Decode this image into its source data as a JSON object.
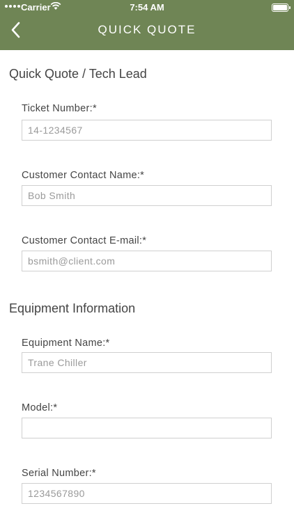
{
  "status_bar": {
    "carrier": "Carrier",
    "time": "7:54 AM"
  },
  "nav": {
    "title": "QUICK QUOTE",
    "back_icon": "chevron-left-icon",
    "background_color": "#6f8555"
  },
  "sections": {
    "lead_title": "Quick Quote / Tech Lead",
    "equipment_title": "Equipment Information"
  },
  "fields": {
    "ticket_number": {
      "label": "Ticket Number:*",
      "placeholder": "14-1234567"
    },
    "contact_name": {
      "label": "Customer Contact Name:*",
      "placeholder": "Bob Smith"
    },
    "contact_email": {
      "label": "Customer Contact E-mail:*",
      "placeholder": "bsmith@client.com"
    },
    "equipment_name": {
      "label": "Equipment Name:*",
      "placeholder": "Trane Chiller"
    },
    "model": {
      "label": "Model:*",
      "placeholder": ""
    },
    "serial_number": {
      "label": "Serial Number:*",
      "placeholder": "1234567890"
    }
  }
}
